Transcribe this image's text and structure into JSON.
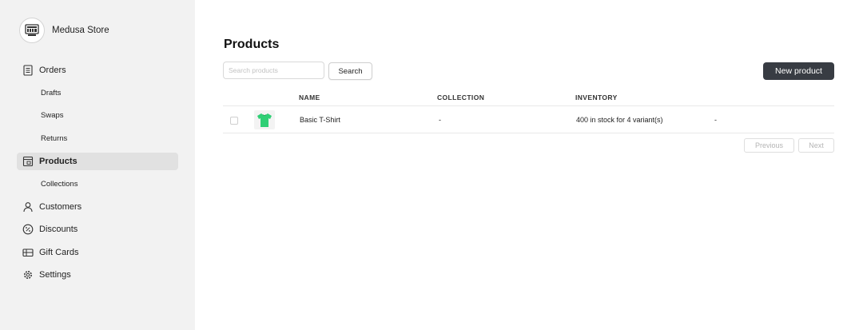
{
  "store": {
    "name": "Medusa Store"
  },
  "sidebar": {
    "orders": {
      "label": "Orders",
      "icon": "orders-icon"
    },
    "drafts": "Drafts",
    "swaps": "Swaps",
    "returns": "Returns",
    "products": {
      "label": "Products",
      "icon": "products-icon",
      "active": true
    },
    "collections": "Collections",
    "customers": {
      "label": "Customers",
      "icon": "customers-icon"
    },
    "discounts": {
      "label": "Discounts",
      "icon": "discounts-icon"
    },
    "gift_cards": {
      "label": "Gift Cards",
      "icon": "gift-card-icon"
    },
    "settings": {
      "label": "Settings",
      "icon": "gear-icon"
    }
  },
  "main": {
    "title": "Products",
    "search": {
      "placeholder": "Search products",
      "value": "",
      "button": "Search"
    },
    "new_product": "New product"
  },
  "table": {
    "headers": {
      "name": "NAME",
      "collection": "COLLECTION",
      "inventory": "INVENTORY"
    },
    "rows": [
      {
        "name": "Basic T-Shirt",
        "collection": "-",
        "inventory": "400 in stock for 4 variant(s)",
        "extra": "-",
        "thumbnail": "green-t-shirt"
      }
    ]
  },
  "pagination": {
    "previous": "Previous",
    "next": "Next"
  },
  "colors": {
    "sidebar_bg": "#f2f2f2",
    "active_item_bg": "#e1e1e1",
    "primary_button": "#383c43",
    "shirt_green": "#2fcf75"
  }
}
